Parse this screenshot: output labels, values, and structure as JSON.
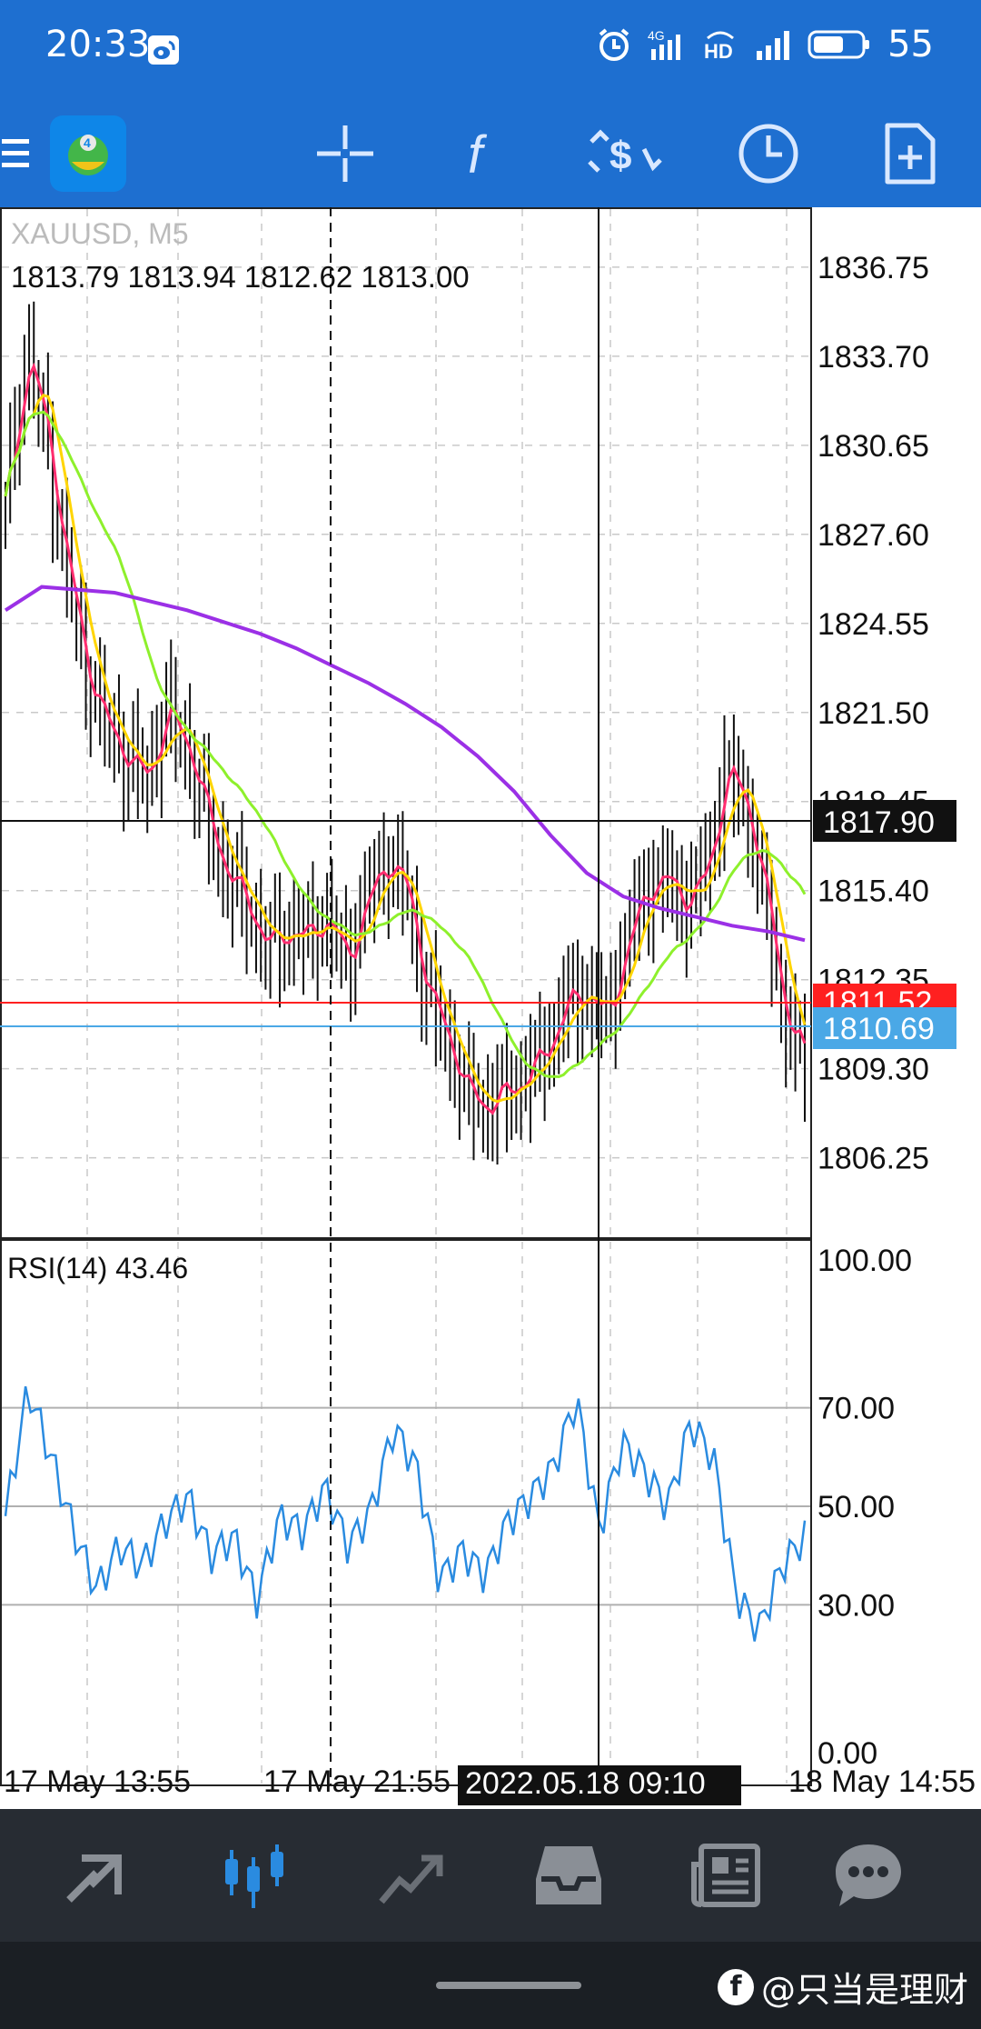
{
  "status_bar": {
    "time": "20:33",
    "battery": "55",
    "network": "4G",
    "hd": "HD",
    "icons": [
      "weibo-icon",
      "alarm-icon",
      "signal-icon",
      "hd-icon",
      "signal-bars-icon",
      "battery-icon"
    ]
  },
  "toolbar": {
    "icons": [
      "menu-icon",
      "app-logo-icon",
      "crosshair-icon",
      "indicators-icon",
      "objects-icon",
      "timeframe-icon",
      "new-order-icon"
    ]
  },
  "chart": {
    "symbol": "XAUUSD, M5",
    "ohlc": "1813.79 1813.94 1812.62 1813.00",
    "price_ticks": [
      "1836.75",
      "1833.70",
      "1830.65",
      "1827.60",
      "1824.55",
      "1821.50",
      "1818.45",
      "1815.40",
      "1812.35",
      "1809.30",
      "1806.25"
    ],
    "crosshair_price": "1817.90",
    "ask_price": "1811.52",
    "bid_price": "1810.69",
    "crosshair_time": "2022.05.18 09:10",
    "time_labels": [
      "17 May 13:55",
      "17 May 21:55",
      "18 May 14:55"
    ],
    "rsi_label": "RSI(14) 43.46",
    "rsi_ticks": [
      "100.00",
      "70.00",
      "50.00",
      "30.00",
      "0.00"
    ],
    "colors": {
      "ma_fast": "#ff2d6f",
      "ma_mid": "#ffd500",
      "ma_slow": "#8ef02c",
      "ma_long": "#9b30e6",
      "ask_line": "#ff2020",
      "bid_line": "#4aa8e6",
      "rsi_line": "#2a8be0"
    }
  },
  "chart_data": [
    {
      "type": "candlestick",
      "title": "XAUUSD, M5",
      "ylim": [
        1803.5,
        1838.8
      ],
      "x": [
        "17 May 13:55",
        "17 May 21:55",
        "2022.05.18 09:10",
        "18 May 14:55"
      ],
      "close": [
        1828.5,
        1834.0,
        1831.0,
        1826.5,
        1823.0,
        1821.0,
        1820.0,
        1819.2,
        1821.5,
        1820.5,
        1818.0,
        1816.0,
        1815.0,
        1813.5,
        1814.0,
        1813.8,
        1814.5,
        1813.0,
        1815.0,
        1816.5,
        1815.5,
        1812.0,
        1810.5,
        1808.5,
        1808.0,
        1808.5,
        1809.0,
        1810.0,
        1811.5,
        1812.0,
        1811.0,
        1813.5,
        1815.5,
        1815.8,
        1815.0,
        1816.0,
        1819.5,
        1818.5,
        1815.0,
        1811.0,
        1809.5
      ],
      "ma_long": [
        1825.0,
        1825.8,
        1825.7,
        1825.6,
        1825.3,
        1825.0,
        1824.6,
        1824.2,
        1823.7,
        1823.1,
        1822.5,
        1821.8,
        1821.0,
        1820.0,
        1818.8,
        1817.3,
        1816.0,
        1815.2,
        1814.8,
        1814.5,
        1814.2,
        1814.0,
        1813.7
      ]
    },
    {
      "type": "line",
      "title": "RSI(14) 43.46",
      "ylim": [
        0,
        100
      ],
      "levels": [
        70,
        50,
        30
      ],
      "values": [
        48,
        74,
        60,
        45,
        33,
        42,
        38,
        47,
        52,
        40,
        44,
        31,
        48,
        45,
        54,
        42,
        49,
        66,
        58,
        35,
        41,
        36,
        47,
        52,
        58,
        72,
        45,
        63,
        57,
        50,
        67,
        60,
        32,
        25,
        38,
        44
      ]
    }
  ],
  "bottom_nav": {
    "items": [
      "quotes-icon",
      "chart-icon",
      "trade-icon",
      "history-icon",
      "news-icon",
      "chat-icon"
    ]
  },
  "watermark": "@只当是理财"
}
